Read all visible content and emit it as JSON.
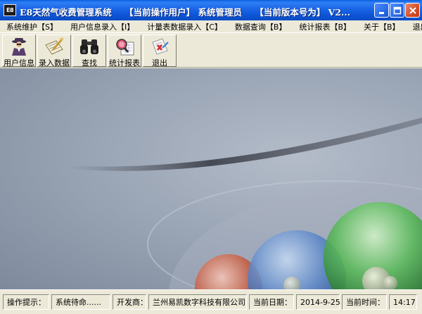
{
  "window": {
    "app_icon_text": "E8",
    "title_app": "E8天然气收费管理系统",
    "title_user": "【当前操作用户】 系统管理员",
    "title_version": "【当前版本号为】 V2..."
  },
  "menu": [
    {
      "label": "系统维护【S】"
    },
    {
      "label": "用户信息录入【I】"
    },
    {
      "label": "计量表数据录入【C】"
    },
    {
      "label": "数据查询【B】"
    },
    {
      "label": "统计报表【B】"
    },
    {
      "label": "关于【B】"
    },
    {
      "label": "退出【X】"
    }
  ],
  "toolbar": [
    {
      "label": "用户信息",
      "icon": "user-agent-icon"
    },
    {
      "label": "录入数据",
      "icon": "quill-paper-icon"
    },
    {
      "label": "查找",
      "icon": "binoculars-icon"
    },
    {
      "label": "统计报表",
      "icon": "magnifier-chart-icon"
    },
    {
      "label": "退出",
      "icon": "exit-icon"
    }
  ],
  "status": {
    "hint_label": "操作提示：",
    "hint_value": "系统待命......",
    "dev_label": "开发商：",
    "dev_value": "兰州易凯数字科技有限公司",
    "date_label": "当前日期：",
    "date_value": "2014-9-25",
    "time_label": "当前时间：",
    "time_value": "14:17"
  },
  "colors": {
    "titlebar": "#0d54d6",
    "chrome": "#ece9d8",
    "desktop": "#9ba6b6"
  }
}
